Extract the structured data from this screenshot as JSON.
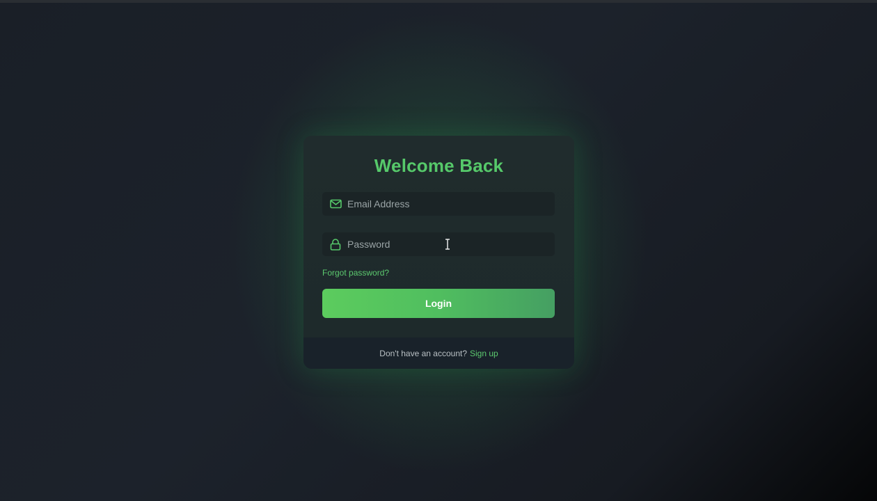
{
  "login_card": {
    "title": "Welcome Back",
    "email": {
      "placeholder": "Email Address",
      "value": "",
      "icon": "mail-icon"
    },
    "password": {
      "placeholder": "Password",
      "value": "",
      "icon": "lock-icon"
    },
    "forgot_password_label": "Forgot password?",
    "login_label": "Login",
    "footer": {
      "prompt": "Don't have an account?",
      "signup_label": "Sign up"
    }
  },
  "colors": {
    "accent": "#56c96a",
    "button_start": "#5ccc5e",
    "button_end": "#459f62",
    "card": "#1f2a2b",
    "footer": "#19222a"
  }
}
